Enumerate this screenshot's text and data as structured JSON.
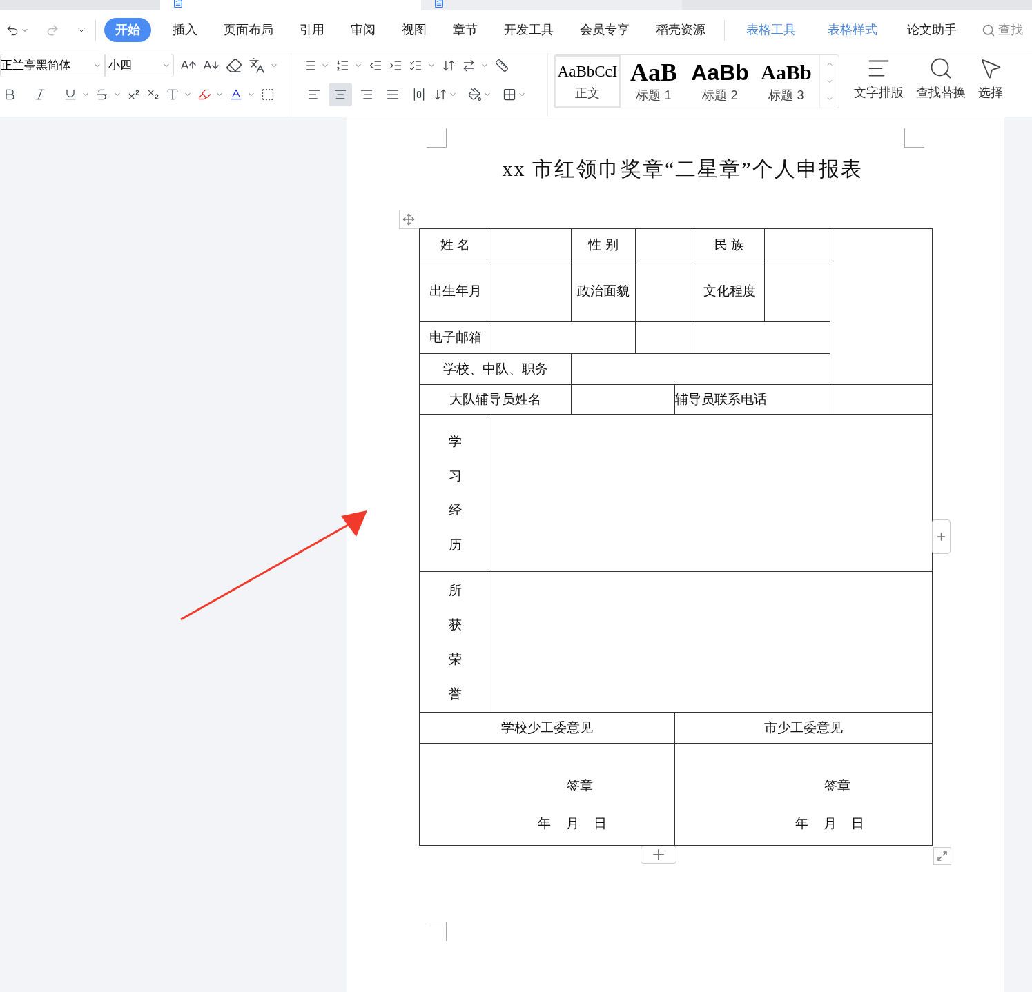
{
  "menu": {
    "tabs": [
      {
        "label": "开始",
        "selected": true
      },
      {
        "label": "插入",
        "selected": false
      },
      {
        "label": "页面布局",
        "selected": false
      },
      {
        "label": "引用",
        "selected": false
      },
      {
        "label": "审阅",
        "selected": false
      },
      {
        "label": "视图",
        "selected": false
      },
      {
        "label": "章节",
        "selected": false
      },
      {
        "label": "开发工具",
        "selected": false
      },
      {
        "label": "会员专享",
        "selected": false
      },
      {
        "label": "稻壳资源",
        "selected": false
      }
    ],
    "context_tabs": [
      {
        "label": "表格工具"
      },
      {
        "label": "表格样式"
      }
    ],
    "extra_tab": "论文助手",
    "search": "查找"
  },
  "toolbar": {
    "font": "正兰亭黑简体",
    "font_size": "小四",
    "alignment": [
      {
        "kind": "left",
        "selected": false
      },
      {
        "kind": "center",
        "selected": true
      },
      {
        "kind": "right",
        "selected": false
      },
      {
        "kind": "justify",
        "selected": false
      },
      {
        "kind": "distribute",
        "selected": false
      }
    ],
    "styles": [
      {
        "preview": "AaBbCcI",
        "label": "正文",
        "selected": true
      },
      {
        "preview": "AaB",
        "label": "标题 1",
        "selected": false
      },
      {
        "preview": "AaBb",
        "label": "标题 2",
        "selected": false
      },
      {
        "preview": "AaBb",
        "label": "标题 3",
        "selected": false
      }
    ],
    "buttons": [
      "文字排版",
      "查找替换",
      "选择"
    ]
  },
  "document": {
    "title": "xx 市红领巾奖章“二星章”个人申报表",
    "labels": {
      "name": "姓 名",
      "gender": "性 别",
      "ethnicity": "民 族",
      "birth": "出生年月",
      "politics": "政治面貌",
      "education": "文化程度",
      "email": "电子邮箱",
      "school": "学校、中队、职务",
      "counselor": "大队辅导员姓名",
      "counselor_phone": "辅导员联系电话",
      "study": "学习经历",
      "honors": "所获荣誉",
      "school_opinion": "学校少工委意见",
      "city_opinion": "市少工委意见"
    },
    "signatures": [
      {
        "seal": "签章",
        "date": "年 月 日"
      },
      {
        "seal": "签章",
        "date": "年 月 日"
      }
    ]
  }
}
